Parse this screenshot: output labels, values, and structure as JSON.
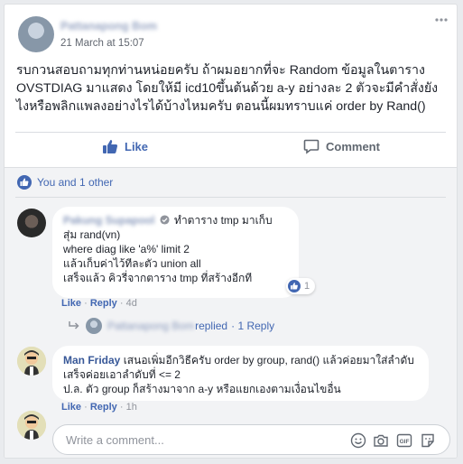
{
  "post": {
    "author": "Pattanapong Bom",
    "time": "21 March at 15:07",
    "text": "รบกวนสอบถามทุกท่านหน่อยครับ ถ้าผมอยากที่จะ Random ข้อมูลในตาราง OVSTDIAG มาแสดง โดยให้มี icd10ขึ้นต้นด้วย a-y อย่างละ 2 ตัวจะมีคำสั่งยังไงหรือพลิกแพลงอย่างไรได้บ้างไหมครับ ตอนนี้ผมทราบแค่ order by Rand()"
  },
  "actions": {
    "like": "Like",
    "comment": "Comment"
  },
  "reactions_summary": "You and 1 other",
  "comment1": {
    "author": "Pakung Supapool",
    "text_line1": "ทำตาราง tmp มาเก็บ",
    "text_line2": "สุ่ม rand(vn)",
    "text_line3": "where diag like 'a%' limit 2",
    "text_line4": "แล้วเก็บค่าไว้ทีละตัว union all",
    "text_line5": "เสร็จแล้ว คิวรี่จากตาราง tmp ที่สร้างอีกที",
    "like": "Like",
    "reply": "Reply",
    "sep": "·",
    "age": "4d",
    "reaction_count": "1"
  },
  "reply_summary": {
    "name": "Pattanapong Bom",
    "action": "replied",
    "count": "· 1 Reply"
  },
  "comment2": {
    "author": "Man Friday",
    "text": "เสนอเพิ่มอีกวิธีครับ order by group, rand() แล้วค่อยมาใส่ลำดับ เสร็จค่อยเอาลำดับที่ <= 2",
    "text2": "ป.ล. ตัว group ก็สร้างมาจาก a-y หรือแยกเองตามเงื่อนไขอื่น",
    "like": "Like",
    "reply": "Reply",
    "sep": "·",
    "age": "1h"
  },
  "composer": {
    "placeholder": "Write a comment..."
  },
  "colors": {
    "brand": "#4267b2",
    "link": "#385898",
    "bg": "#e9ebee",
    "comment_area": "#f2f3f5"
  }
}
